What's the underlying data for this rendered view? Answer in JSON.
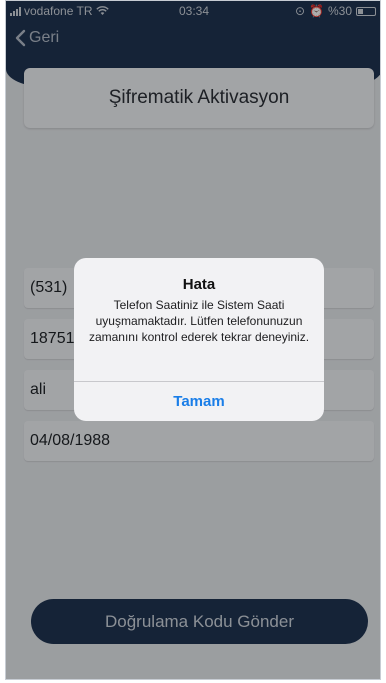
{
  "status_bar": {
    "carrier": "vodafone TR",
    "time": "03:34",
    "battery": "%30"
  },
  "nav": {
    "back_label": "Geri"
  },
  "page": {
    "title": "Şifrematik Aktivasyon"
  },
  "form": {
    "fields": [
      {
        "value": "(531)"
      },
      {
        "value": "18751"
      },
      {
        "value": "ali"
      },
      {
        "value": "04/08/1988"
      }
    ],
    "submit_label": "Doğrulama Kodu Gönder"
  },
  "alert": {
    "title": "Hata",
    "message": "Telefon Saatiniz ile Sistem Saati uyuşmamaktadır. Lütfen telefonunuzun zamanını kontrol ederek tekrar deneyiniz.",
    "button_label": "Tamam"
  },
  "colors": {
    "navy": "#1f3350",
    "alert_button": "#1a7ee8"
  }
}
